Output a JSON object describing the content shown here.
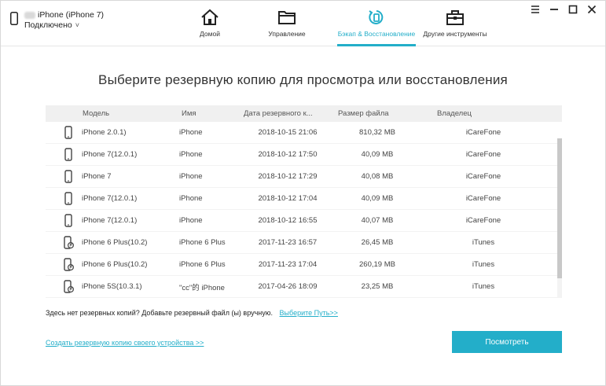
{
  "device": {
    "name": "iPhone (iPhone 7)",
    "status": "Подключено",
    "chevron": "˅"
  },
  "nav": [
    {
      "label": "Домой",
      "icon": "home-icon"
    },
    {
      "label": "Управление",
      "icon": "folder-icon"
    },
    {
      "label": "Бэкап & Восстановление",
      "icon": "backup-restore-icon",
      "active": true
    },
    {
      "label": "Другие инструменты",
      "icon": "toolbox-icon"
    }
  ],
  "window_controls": [
    "menu-icon",
    "minimize-icon",
    "maximize-icon",
    "close-icon"
  ],
  "title": "Выберите резервную копию для просмотра или восстановления",
  "table": {
    "headers": {
      "model": "Модель",
      "name": "Имя",
      "date": "Дата резервного к...",
      "size": "Размер файла",
      "owner": "Владелец"
    },
    "rows": [
      {
        "model": "iPhone  2.0.1)",
        "name": " iPhone",
        "date": "2018-10-15 21:06",
        "size": "810,32 MB",
        "owner": "iCareFone",
        "icon": "phone-icon"
      },
      {
        "model": "iPhone 7(12.0.1)",
        "name": " iPhone",
        "date": "2018-10-12 17:50",
        "size": "40,09 MB",
        "owner": "iCareFone",
        "icon": "phone-icon"
      },
      {
        "model": "iPhone 7",
        "name": " iPhone",
        "date": "2018-10-12 17:29",
        "size": "40,08 MB",
        "owner": "iCareFone",
        "icon": "phone-icon"
      },
      {
        "model": "iPhone 7(12.0.1)",
        "name": " iPhone",
        "date": "2018-10-12 17:04",
        "size": "40,09 MB",
        "owner": "iCareFone",
        "icon": "phone-icon"
      },
      {
        "model": "iPhone 7(12.0.1)",
        "name": " iPhone",
        "date": "2018-10-12 16:55",
        "size": "40,07 MB",
        "owner": "iCareFone",
        "icon": "phone-icon"
      },
      {
        "model": "iPhone 6 Plus(10.2)",
        "name": "iPhone 6 Plus",
        "date": "2017-11-23 16:57",
        "size": "26,45 MB",
        "owner": "iTunes",
        "icon": "itunes-phone-icon"
      },
      {
        "model": "iPhone 6 Plus(10.2)",
        "name": "iPhone 6 Plus",
        "date": "2017-11-23 17:04",
        "size": "260,19 MB",
        "owner": "iTunes",
        "icon": "itunes-phone-icon"
      },
      {
        "model": "iPhone 5S(10.3.1)",
        "name": "\"cc\"的 iPhone",
        "date": "2017-04-26 18:09",
        "size": "23,25 MB",
        "owner": "iTunes",
        "icon": "itunes-phone-icon"
      }
    ]
  },
  "footer": {
    "note": "Здесь нет резервных копий? Добавьте резервный файл (ы) вручную.",
    "choose_path": "Выберите Путь>>",
    "create_backup": "Создать резервную копию своего устройства >>",
    "view_button": "Посмотреть"
  },
  "colors": {
    "accent": "#23aec9",
    "header_bg": "#f0f0f0"
  }
}
